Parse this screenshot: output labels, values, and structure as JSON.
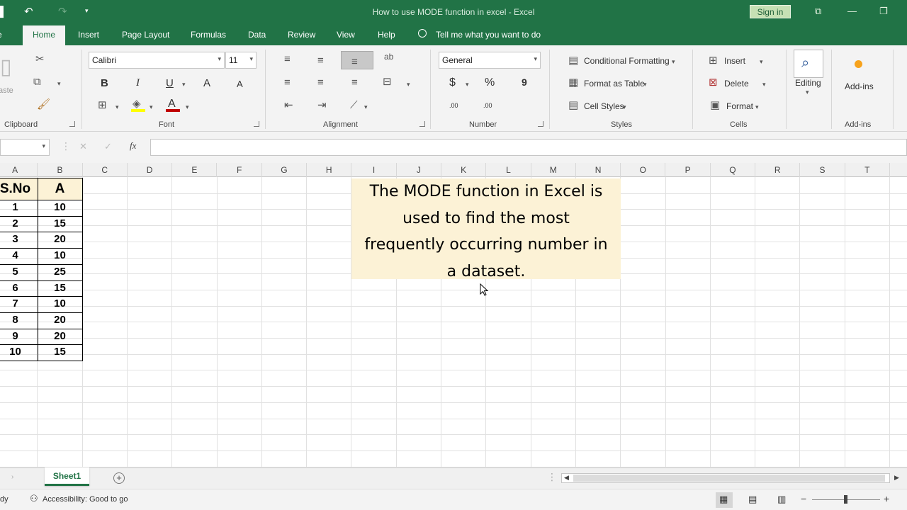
{
  "window": {
    "title": "How to  use MODE function in excel  -  Excel",
    "sign_in": "Sign in",
    "accent_color": "#217346"
  },
  "tabs": {
    "home": "Home",
    "insert": "Insert",
    "page_layout": "Page Layout",
    "formulas": "Formulas",
    "data": "Data",
    "review": "Review",
    "view": "View",
    "help": "Help",
    "tell_me": "Tell me what you want to do"
  },
  "ribbon": {
    "clipboard": {
      "label": "Clipboard",
      "paste": "aste"
    },
    "font": {
      "label": "Font",
      "font_name": "Calibri",
      "font_size": "11",
      "bold": "B",
      "italic": "I",
      "underline": "U",
      "grow": "A",
      "shrink": "A",
      "font_color": "A"
    },
    "alignment": {
      "label": "Alignment"
    },
    "number": {
      "label": "Number",
      "format": "General",
      "currency": "$",
      "percent": "%",
      "comma": "9",
      "inc_decimal": ".00",
      "dec_decimal": ".00"
    },
    "styles": {
      "label": "Styles",
      "conditional": "Conditional Formatting",
      "format_table": "Format as Table",
      "cell_styles": "Cell Styles"
    },
    "cells": {
      "label": "Cells",
      "insert": "Insert",
      "delete": "Delete",
      "format": "Format"
    },
    "editing": {
      "label": "Editing"
    },
    "addins": {
      "label": "Add-ins",
      "button": "Add-ins"
    }
  },
  "formula_bar": {
    "fx": "fx",
    "cancel": "✕",
    "enter": "✓"
  },
  "columns": [
    "A",
    "B",
    "C",
    "D",
    "E",
    "F",
    "G",
    "H",
    "I",
    "J",
    "K",
    "L",
    "M",
    "N",
    "O",
    "P",
    "Q",
    "R",
    "S",
    "T"
  ],
  "table": {
    "headers": [
      "S.No",
      "A"
    ],
    "rows": [
      [
        "1",
        "10"
      ],
      [
        "2",
        "15"
      ],
      [
        "3",
        "20"
      ],
      [
        "4",
        "10"
      ],
      [
        "5",
        "25"
      ],
      [
        "6",
        "15"
      ],
      [
        "7",
        "10"
      ],
      [
        "8",
        "20"
      ],
      [
        "9",
        "20"
      ],
      [
        "10",
        "15"
      ]
    ]
  },
  "callout": {
    "line1": "The MODE function in Excel is",
    "line2": "used to find the most",
    "line3": "frequently occurring number in",
    "line4": "a dataset."
  },
  "sheets": {
    "active": "Sheet1"
  },
  "status": {
    "ready": "dy",
    "accessibility": "Accessibility: Good to go"
  }
}
